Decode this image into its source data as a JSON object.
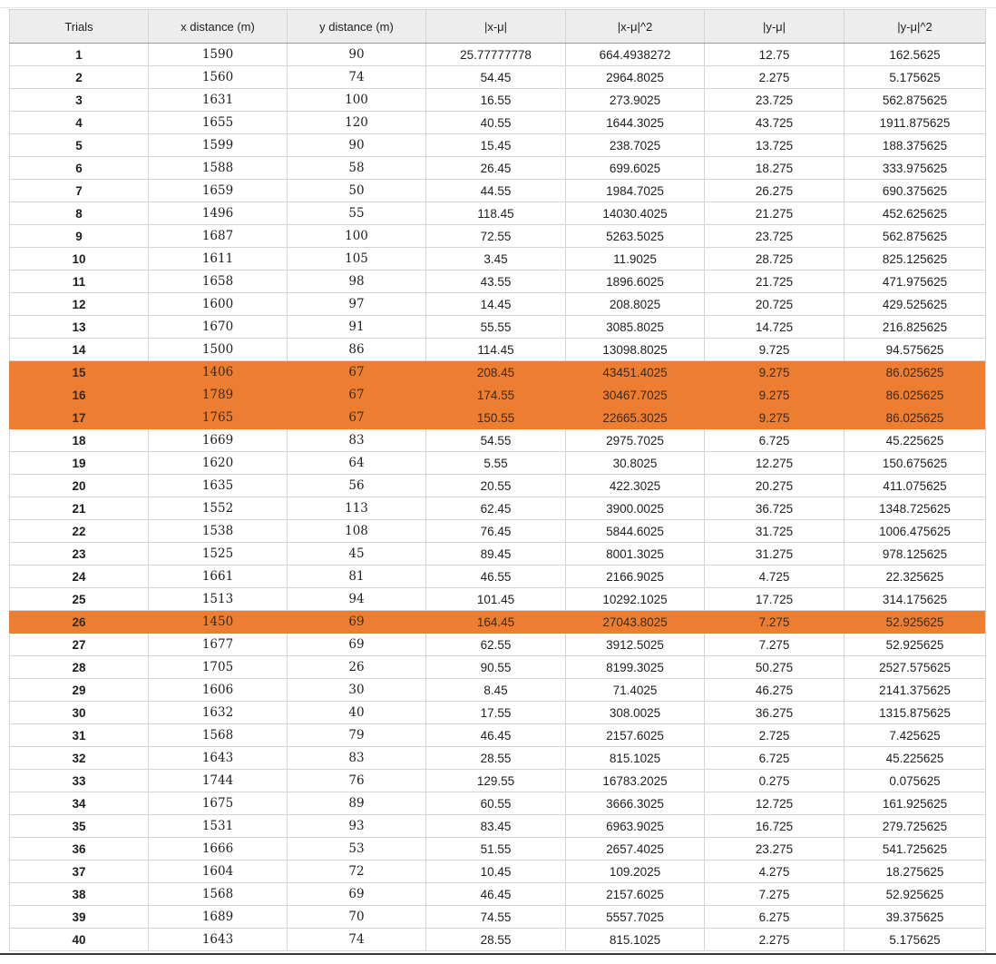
{
  "sheet": {
    "columns": [
      "Trials",
      "x distance (m)",
      "y distance (m)",
      "|x-μ|",
      "|x-μ|^2",
      "|y-μ|",
      "|y-μ|^2"
    ],
    "highlight_color": "#ed7d31",
    "rows": [
      {
        "trial": "1",
        "x": "1590",
        "y": "90",
        "dx": "25.77777778",
        "dx2": "664.4938272",
        "dy": "12.75",
        "dy2": "162.5625",
        "hl": false
      },
      {
        "trial": "2",
        "x": "1560",
        "y": "74",
        "dx": "54.45",
        "dx2": "2964.8025",
        "dy": "2.275",
        "dy2": "5.175625",
        "hl": false
      },
      {
        "trial": "3",
        "x": "1631",
        "y": "100",
        "dx": "16.55",
        "dx2": "273.9025",
        "dy": "23.725",
        "dy2": "562.875625",
        "hl": false
      },
      {
        "trial": "4",
        "x": "1655",
        "y": "120",
        "dx": "40.55",
        "dx2": "1644.3025",
        "dy": "43.725",
        "dy2": "1911.875625",
        "hl": false
      },
      {
        "trial": "5",
        "x": "1599",
        "y": "90",
        "dx": "15.45",
        "dx2": "238.7025",
        "dy": "13.725",
        "dy2": "188.375625",
        "hl": false
      },
      {
        "trial": "6",
        "x": "1588",
        "y": "58",
        "dx": "26.45",
        "dx2": "699.6025",
        "dy": "18.275",
        "dy2": "333.975625",
        "hl": false
      },
      {
        "trial": "7",
        "x": "1659",
        "y": "50",
        "dx": "44.55",
        "dx2": "1984.7025",
        "dy": "26.275",
        "dy2": "690.375625",
        "hl": false
      },
      {
        "trial": "8",
        "x": "1496",
        "y": "55",
        "dx": "118.45",
        "dx2": "14030.4025",
        "dy": "21.275",
        "dy2": "452.625625",
        "hl": false
      },
      {
        "trial": "9",
        "x": "1687",
        "y": "100",
        "dx": "72.55",
        "dx2": "5263.5025",
        "dy": "23.725",
        "dy2": "562.875625",
        "hl": false
      },
      {
        "trial": "10",
        "x": "1611",
        "y": "105",
        "dx": "3.45",
        "dx2": "11.9025",
        "dy": "28.725",
        "dy2": "825.125625",
        "hl": false
      },
      {
        "trial": "11",
        "x": "1658",
        "y": "98",
        "dx": "43.55",
        "dx2": "1896.6025",
        "dy": "21.725",
        "dy2": "471.975625",
        "hl": false
      },
      {
        "trial": "12",
        "x": "1600",
        "y": "97",
        "dx": "14.45",
        "dx2": "208.8025",
        "dy": "20.725",
        "dy2": "429.525625",
        "hl": false
      },
      {
        "trial": "13",
        "x": "1670",
        "y": "91",
        "dx": "55.55",
        "dx2": "3085.8025",
        "dy": "14.725",
        "dy2": "216.825625",
        "hl": false
      },
      {
        "trial": "14",
        "x": "1500",
        "y": "86",
        "dx": "114.45",
        "dx2": "13098.8025",
        "dy": "9.725",
        "dy2": "94.575625",
        "hl": false
      },
      {
        "trial": "15",
        "x": "1406",
        "y": "67",
        "dx": "208.45",
        "dx2": "43451.4025",
        "dy": "9.275",
        "dy2": "86.025625",
        "hl": true
      },
      {
        "trial": "16",
        "x": "1789",
        "y": "67",
        "dx": "174.55",
        "dx2": "30467.7025",
        "dy": "9.275",
        "dy2": "86.025625",
        "hl": true
      },
      {
        "trial": "17",
        "x": "1765",
        "y": "67",
        "dx": "150.55",
        "dx2": "22665.3025",
        "dy": "9.275",
        "dy2": "86.025625",
        "hl": true
      },
      {
        "trial": "18",
        "x": "1669",
        "y": "83",
        "dx": "54.55",
        "dx2": "2975.7025",
        "dy": "6.725",
        "dy2": "45.225625",
        "hl": false
      },
      {
        "trial": "19",
        "x": "1620",
        "y": "64",
        "dx": "5.55",
        "dx2": "30.8025",
        "dy": "12.275",
        "dy2": "150.675625",
        "hl": false
      },
      {
        "trial": "20",
        "x": "1635",
        "y": "56",
        "dx": "20.55",
        "dx2": "422.3025",
        "dy": "20.275",
        "dy2": "411.075625",
        "hl": false
      },
      {
        "trial": "21",
        "x": "1552",
        "y": "113",
        "dx": "62.45",
        "dx2": "3900.0025",
        "dy": "36.725",
        "dy2": "1348.725625",
        "hl": false
      },
      {
        "trial": "22",
        "x": "1538",
        "y": "108",
        "dx": "76.45",
        "dx2": "5844.6025",
        "dy": "31.725",
        "dy2": "1006.475625",
        "hl": false
      },
      {
        "trial": "23",
        "x": "1525",
        "y": "45",
        "dx": "89.45",
        "dx2": "8001.3025",
        "dy": "31.275",
        "dy2": "978.125625",
        "hl": false
      },
      {
        "trial": "24",
        "x": "1661",
        "y": "81",
        "dx": "46.55",
        "dx2": "2166.9025",
        "dy": "4.725",
        "dy2": "22.325625",
        "hl": false
      },
      {
        "trial": "25",
        "x": "1513",
        "y": "94",
        "dx": "101.45",
        "dx2": "10292.1025",
        "dy": "17.725",
        "dy2": "314.175625",
        "hl": false
      },
      {
        "trial": "26",
        "x": "1450",
        "y": "69",
        "dx": "164.45",
        "dx2": "27043.8025",
        "dy": "7.275",
        "dy2": "52.925625",
        "hl": true
      },
      {
        "trial": "27",
        "x": "1677",
        "y": "69",
        "dx": "62.55",
        "dx2": "3912.5025",
        "dy": "7.275",
        "dy2": "52.925625",
        "hl": false
      },
      {
        "trial": "28",
        "x": "1705",
        "y": "26",
        "dx": "90.55",
        "dx2": "8199.3025",
        "dy": "50.275",
        "dy2": "2527.575625",
        "hl": false
      },
      {
        "trial": "29",
        "x": "1606",
        "y": "30",
        "dx": "8.45",
        "dx2": "71.4025",
        "dy": "46.275",
        "dy2": "2141.375625",
        "hl": false
      },
      {
        "trial": "30",
        "x": "1632",
        "y": "40",
        "dx": "17.55",
        "dx2": "308.0025",
        "dy": "36.275",
        "dy2": "1315.875625",
        "hl": false
      },
      {
        "trial": "31",
        "x": "1568",
        "y": "79",
        "dx": "46.45",
        "dx2": "2157.6025",
        "dy": "2.725",
        "dy2": "7.425625",
        "hl": false
      },
      {
        "trial": "32",
        "x": "1643",
        "y": "83",
        "dx": "28.55",
        "dx2": "815.1025",
        "dy": "6.725",
        "dy2": "45.225625",
        "hl": false
      },
      {
        "trial": "33",
        "x": "1744",
        "y": "76",
        "dx": "129.55",
        "dx2": "16783.2025",
        "dy": "0.275",
        "dy2": "0.075625",
        "hl": false
      },
      {
        "trial": "34",
        "x": "1675",
        "y": "89",
        "dx": "60.55",
        "dx2": "3666.3025",
        "dy": "12.725",
        "dy2": "161.925625",
        "hl": false
      },
      {
        "trial": "35",
        "x": "1531",
        "y": "93",
        "dx": "83.45",
        "dx2": "6963.9025",
        "dy": "16.725",
        "dy2": "279.725625",
        "hl": false
      },
      {
        "trial": "36",
        "x": "1666",
        "y": "53",
        "dx": "51.55",
        "dx2": "2657.4025",
        "dy": "23.275",
        "dy2": "541.725625",
        "hl": false
      },
      {
        "trial": "37",
        "x": "1604",
        "y": "72",
        "dx": "10.45",
        "dx2": "109.2025",
        "dy": "4.275",
        "dy2": "18.275625",
        "hl": false
      },
      {
        "trial": "38",
        "x": "1568",
        "y": "69",
        "dx": "46.45",
        "dx2": "2157.6025",
        "dy": "7.275",
        "dy2": "52.925625",
        "hl": false
      },
      {
        "trial": "39",
        "x": "1689",
        "y": "70",
        "dx": "74.55",
        "dx2": "5557.7025",
        "dy": "6.275",
        "dy2": "39.375625",
        "hl": false
      },
      {
        "trial": "40",
        "x": "1643",
        "y": "74",
        "dx": "28.55",
        "dx2": "815.1025",
        "dy": "2.275",
        "dy2": "5.175625",
        "hl": false
      }
    ]
  }
}
